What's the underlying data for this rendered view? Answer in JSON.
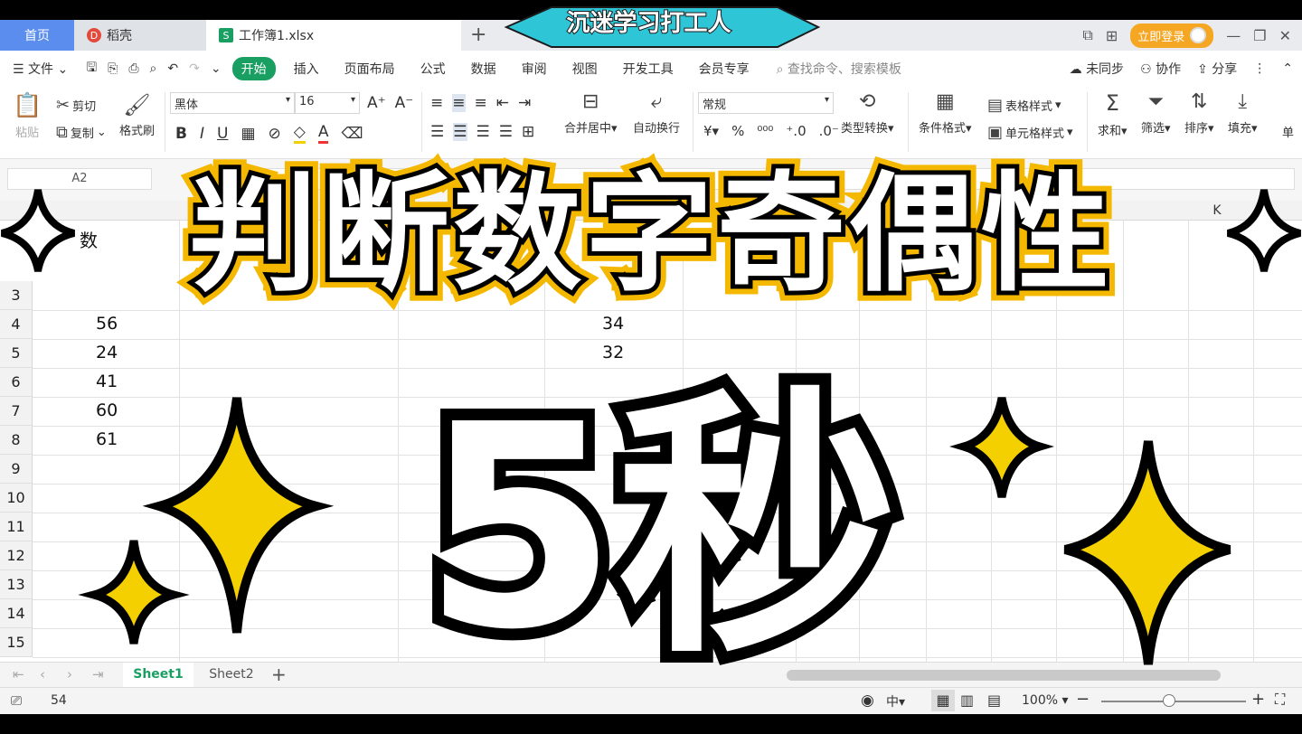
{
  "titlebar": {
    "home_tab": "首页",
    "docer_tab": "稻壳",
    "file_tab": "工作簿1.xlsx",
    "login_label": "立即登录"
  },
  "menubar": {
    "file_label": "文件",
    "items": [
      "开始",
      "插入",
      "页面布局",
      "公式",
      "数据",
      "审阅",
      "视图",
      "开发工具",
      "会员专享"
    ],
    "search_placeholder": "查找命令、搜索模板",
    "right": [
      "未同步",
      "协作",
      "分享"
    ]
  },
  "ribbon": {
    "paste": "粘贴",
    "cut": "剪切",
    "copy": "复制",
    "format_painter": "格式刷",
    "font_name": "黑体",
    "font_size": "16",
    "merge_center": "合并居中",
    "wrap_text": "自动换行",
    "number_format": "常规",
    "type_convert": "类型转换",
    "conditional_format": "条件格式",
    "table_style": "表格样式",
    "cell_style": "单元格样式",
    "sum": "求和",
    "filter": "筛选",
    "sort": "排序",
    "fill": "填充",
    "cell_partial": "单"
  },
  "formula_bar": {
    "name_box": "A2"
  },
  "grid": {
    "col_k": "K",
    "header_a_partial": "数",
    "row_numbers": [
      "3",
      "4",
      "5",
      "6",
      "7",
      "8",
      "9",
      "10",
      "11",
      "12",
      "13",
      "14",
      "15"
    ],
    "col_a_values": [
      "56",
      "24",
      "41",
      "60",
      "61"
    ],
    "col_e_values": [
      "34",
      "32"
    ]
  },
  "sheets": {
    "sheet1": "Sheet1",
    "sheet2": "Sheet2"
  },
  "statusbar": {
    "value": "54",
    "zoom": "100%"
  },
  "overlay": {
    "banner": "沉迷学习打工人",
    "title": "判断数字奇偶性",
    "timer": "5秒"
  },
  "colors": {
    "accent_green": "#1a9f63",
    "tab_blue": "#5b8def",
    "star_yellow": "#f5d000",
    "title_outline": "#f5b800"
  }
}
